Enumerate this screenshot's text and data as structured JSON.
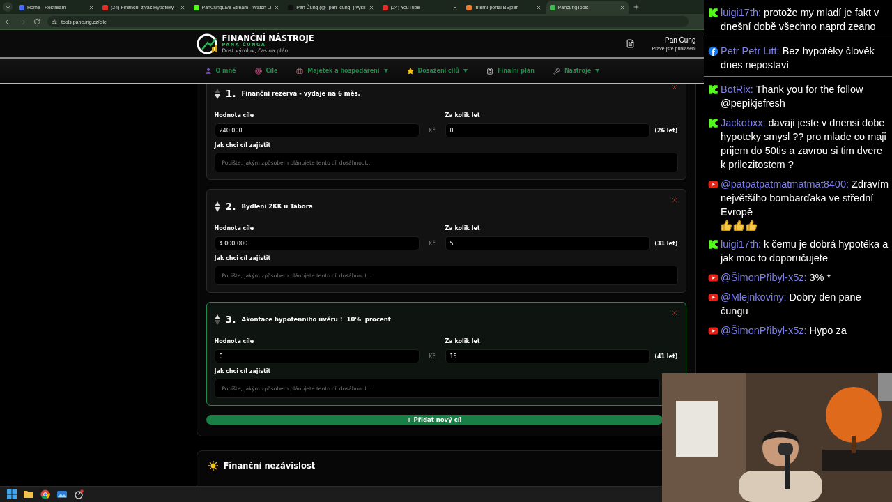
{
  "browser": {
    "tabs": [
      {
        "title": "Home - Restream",
        "color": "#4a6cf7",
        "selected": false
      },
      {
        "title": "(24) Finanční živák Hypotéky -",
        "color": "#e52d27",
        "selected": false
      },
      {
        "title": "PanCungLive Stream - Watch Li",
        "color": "#53fc18",
        "selected": false
      },
      {
        "title": "Pan Čung (@_pan_cung_) vysíl",
        "color": "#111111",
        "selected": false
      },
      {
        "title": "(24) YouTube",
        "color": "#e52d27",
        "selected": false
      },
      {
        "title": "Interní portál BEplan",
        "color": "#f07c2a",
        "selected": false
      },
      {
        "title": "PancungTools",
        "color": "#3fb950",
        "selected": true
      }
    ],
    "url": "tools.pancung.cz/cile"
  },
  "header": {
    "title": "FINANČNÍ NÁSTROJE",
    "subtitle": "PANA ČUNGA",
    "tagline": "Dost výmluv, čas na plán.",
    "user_name": "Pan Čung",
    "user_status": "Právě jste přihlášeni"
  },
  "nav": [
    {
      "label": "O mně",
      "kind": "user",
      "dropdown": false
    },
    {
      "label": "Cíle",
      "kind": "target",
      "dropdown": false
    },
    {
      "label": "Majetek a hospodaření",
      "kind": "briefcase",
      "dropdown": true
    },
    {
      "label": "Dosažení cílů",
      "kind": "star",
      "dropdown": true
    },
    {
      "label": "Finální plán",
      "kind": "clipboard",
      "dropdown": false
    },
    {
      "label": "Nástroje",
      "kind": "tools",
      "dropdown": true
    }
  ],
  "goals": [
    {
      "number": "1.",
      "title": "Finanční rezerva - výdaje na 6 měs.",
      "value_label": "Hodnota cíle",
      "value": "240 000",
      "currency": "Kč",
      "years_label": "Za kolik let",
      "years": "0",
      "years_note": "(26 let)",
      "plan_label": "Jak chci cíl zajistit",
      "plan_placeholder": "Popište, jakým způsobem plánujete tento cíl dosáhnout...",
      "selected": false,
      "up_disabled": true,
      "down_disabled": false
    },
    {
      "number": "2.",
      "title": "Bydlení 2KK u Tábora",
      "value_label": "Hodnota cíle",
      "value": "4 000 000",
      "currency": "Kč",
      "years_label": "Za kolik let",
      "years": "5",
      "years_note": "(31 let)",
      "plan_label": "Jak chci cíl zajistit",
      "plan_placeholder": "Popište, jakým způsobem plánujete tento cíl dosáhnout...",
      "selected": false,
      "up_disabled": false,
      "down_disabled": false
    },
    {
      "number": "3.",
      "title": "Akontace hypotenního úvěru !  10%  procent",
      "value_label": "Hodnota cíle",
      "value": "0",
      "currency": "Kč",
      "years_label": "Za kolik let",
      "years": "15",
      "years_note": "(41 let)",
      "plan_label": "Jak chci cíl zajistit",
      "plan_placeholder": "Popište, jakým způsobem plánujete tento cíl dosáhnout...",
      "selected": true,
      "up_disabled": false,
      "down_disabled": true
    }
  ],
  "add_button": "+ Přidat nový cíl",
  "independence": {
    "title": "Finanční nezávislost"
  },
  "chat": [
    {
      "kind": "kick",
      "user": "luigi17th:",
      "text": "protože my mladí je fakt v dnešní době všechno naprd zeano",
      "separated": true
    },
    {
      "kind": "facebook",
      "user": "Petr Petr Litt:",
      "text": "Bez hypotéky člověk dnes nepostaví",
      "separated": true
    },
    {
      "kind": "kick",
      "user": "BotRix:",
      "text": "Thank you for the follow @pepikjefresh",
      "separated": false
    },
    {
      "kind": "kick",
      "user": "Jackobxx:",
      "text": "davaji jeste v dnensi dobe hypoteky smysl ?? pro mlade co maji prijem do 50tis a zavrou si tim dvere k prilezitostem ?",
      "separated": false
    },
    {
      "kind": "youtube",
      "user": "@patpatpatmatmatmat8400:",
      "text": "Zdravím největšího bombarďaka ve střední Evropě",
      "emojis": [
        {
          "kind": "thumbs_up"
        },
        {
          "kind": "thumbs_up"
        },
        {
          "kind": "thumbs_up"
        }
      ],
      "separated": false
    },
    {
      "kind": "kick",
      "user": "luigi17th:",
      "text": "k čemu je dobrá hypotéka a jak moc to doporučujete",
      "separated": false
    },
    {
      "kind": "youtube",
      "user": "@ŠimonPřibyl-x5z:",
      "text": "3% *",
      "separated": false
    },
    {
      "kind": "youtube",
      "user": "@Mlejnkoviny:",
      "text": "Dobry den pane čungu",
      "separated": false
    },
    {
      "kind": "youtube",
      "user": "@ŠimonPřibyl-x5z:",
      "text": "Hypo za",
      "separated": false
    }
  ]
}
